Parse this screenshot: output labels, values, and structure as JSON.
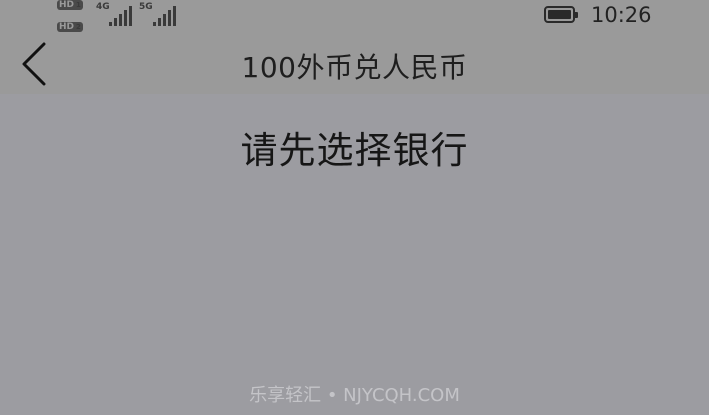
{
  "status_bar": {
    "hd_label_1": "HD",
    "hd_sub_1": "1",
    "hd_label_2": "HD",
    "hd_sub_2": "2",
    "network_1": "4G",
    "network_2": "5G",
    "time": "10:26",
    "battery_level": 1.0
  },
  "header": {
    "title": "100外币兑人民币",
    "back_icon": "chevron-left-icon"
  },
  "main": {
    "prompt": "请先选择银行"
  },
  "watermark": {
    "text": "乐享轻汇 • NJYCQH.COM"
  },
  "colors": {
    "background": "#9c9ca1",
    "bar_background": "#9a9a9a",
    "text": "#1a1a1a",
    "watermark": "#c4c4c8"
  }
}
